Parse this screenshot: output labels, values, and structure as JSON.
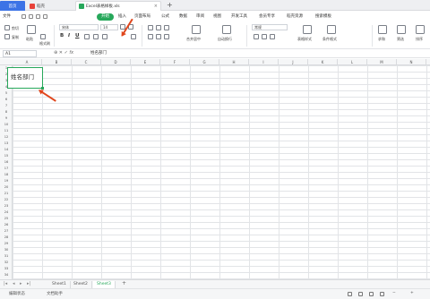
{
  "tabs": {
    "home": "首页",
    "docer": "稻壳",
    "file": "Excel表格样板.xls",
    "add": "+"
  },
  "menu": [
    "文件",
    "开始",
    "插入",
    "页面布局",
    "公式",
    "数据",
    "审阅",
    "视图",
    "开发工具",
    "会员专享",
    "稻壳资源",
    "搜索模板"
  ],
  "ribbon": {
    "cut": "剪切",
    "copy": "复制",
    "paste": "粘贴",
    "format_painter": "格式刷",
    "font_name": "宋体",
    "font_size": "14",
    "bold": "B",
    "italic": "I",
    "underline": "U",
    "merge": "合并居中",
    "wrap": "自动换行",
    "number_format": "常规",
    "cond_format": "条件格式",
    "table_style": "表格样式",
    "sum": "求和",
    "filter": "筛选",
    "sort": "排序",
    "fill": "填充"
  },
  "formula_bar": {
    "cell_ref": "A1",
    "fx": "fx",
    "content": "姓名部门"
  },
  "columns": [
    "A",
    "B",
    "C",
    "D",
    "E",
    "F",
    "G",
    "H",
    "I",
    "J",
    "K",
    "L",
    "M",
    "N"
  ],
  "rows": [
    "1",
    "2",
    "3",
    "4",
    "5",
    "6",
    "7",
    "8",
    "9",
    "10",
    "11",
    "12",
    "13",
    "14",
    "15",
    "16",
    "17",
    "18",
    "19",
    "20",
    "21",
    "22",
    "23",
    "24",
    "25",
    "26",
    "27",
    "28",
    "29",
    "30",
    "31",
    "32",
    "33",
    "34"
  ],
  "cell_a1": "姓名部门",
  "sheets": [
    "Sheet1",
    "Sheet2",
    "Sheet3"
  ],
  "status": {
    "assist": "编辑状态",
    "settings": "文档助手"
  },
  "colors": {
    "accent": "#27a85b",
    "tab_blue": "#3c73e6",
    "arrow": "#e0461c"
  }
}
